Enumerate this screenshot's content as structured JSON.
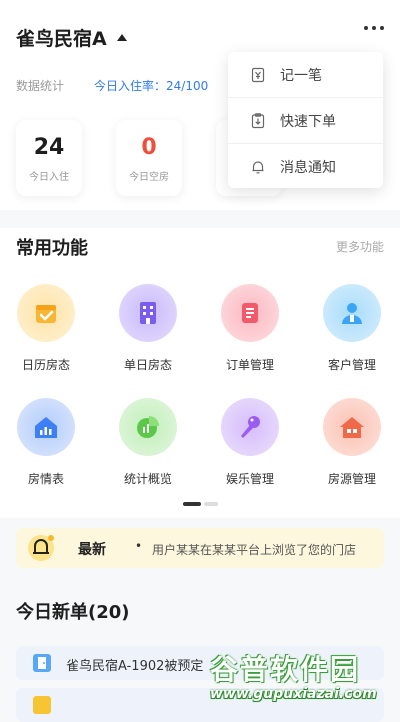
{
  "header": {
    "hotel_name": "雀鸟民宿A"
  },
  "stats": {
    "label": "数据统计",
    "rate_text": "今日入住率：24/100",
    "cards": [
      {
        "num": "24",
        "label": "今日入住"
      },
      {
        "num": "0",
        "label": "今日空房"
      }
    ]
  },
  "dropdown": {
    "items": [
      {
        "label": "记一笔",
        "icon": "yen-note-icon"
      },
      {
        "label": "快速下单",
        "icon": "clipboard-download-icon"
      },
      {
        "label": "消息通知",
        "icon": "bell-icon"
      }
    ]
  },
  "functions": {
    "title": "常用功能",
    "more": "更多功能",
    "items": [
      {
        "label": "日历房态",
        "icon": "calendar-check-icon",
        "color": "#f7b733"
      },
      {
        "label": "单日房态",
        "icon": "building-icon",
        "color": "#7c5cf0"
      },
      {
        "label": "订单管理",
        "icon": "order-list-icon",
        "color": "#f25a6b"
      },
      {
        "label": "客户管理",
        "icon": "user-icon",
        "color": "#3aa5f5"
      },
      {
        "label": "房情表",
        "icon": "house-chart-icon",
        "color": "#3d7ff5"
      },
      {
        "label": "统计概览",
        "icon": "pie-chart-icon",
        "color": "#5cc84a"
      },
      {
        "label": "娱乐管理",
        "icon": "microphone-icon",
        "color": "#9b5cf0"
      },
      {
        "label": "房源管理",
        "icon": "house-icon",
        "color": "#f06a4a"
      }
    ]
  },
  "notice": {
    "tag": "最新",
    "separator": "•",
    "message": "用户某某在某某平台上浏览了您的门店"
  },
  "orders": {
    "title": "今日新单(20)",
    "items": [
      {
        "text": "雀鸟民宿A-1902被预定"
      }
    ]
  },
  "watermark": {
    "top": "谷普软件园",
    "bottom": "www.gupuxiazai.com"
  }
}
